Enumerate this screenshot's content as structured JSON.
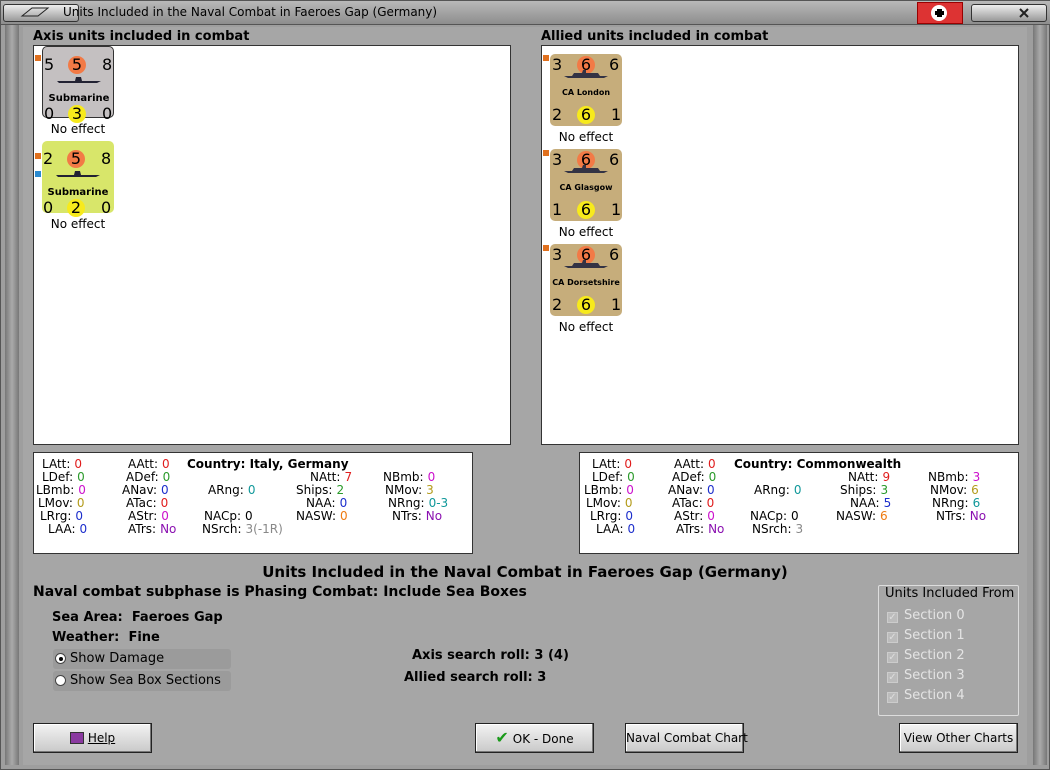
{
  "window": {
    "title": "Units Included in the Naval Combat in Faeroes Gap (Germany)"
  },
  "axis": {
    "heading": "Axis units included in combat",
    "units": [
      {
        "att": "5",
        "mid": "5",
        "def": "8",
        "name": "Submarine",
        "l": "0",
        "y": "3",
        "r": "0",
        "effect": "No effect"
      },
      {
        "att": "2",
        "mid": "5",
        "def": "8",
        "name": "Submarine",
        "l": "0",
        "y": "2",
        "r": "0",
        "effect": "No effect"
      }
    ],
    "stats": {
      "country_label": "Country:",
      "country": "Italy, Germany",
      "LAtt": "0",
      "LDef": "0",
      "LBmb": "0",
      "LMov": "0",
      "LRrg": "0",
      "LAA": "0",
      "AAtt": "0",
      "ADef": "0",
      "ANav": "0",
      "ATac": "0",
      "AStr": "0",
      "ATrs": "No",
      "ARng": "0",
      "NACp": "0",
      "NSrch": "3(-1R)",
      "NAtt": "7",
      "Ships": "2",
      "NAA": "0",
      "NASW": "0",
      "NBmb": "0",
      "NMov": "3",
      "NRng": "0-3",
      "NTrs": "No"
    }
  },
  "allied": {
    "heading": "Allied units included in combat",
    "units": [
      {
        "att": "3",
        "mid": "6",
        "def": "6",
        "name": "CA London",
        "l": "2",
        "y": "6",
        "r": "1",
        "effect": "No effect"
      },
      {
        "att": "3",
        "mid": "6",
        "def": "6",
        "name": "CA Glasgow",
        "l": "1",
        "y": "6",
        "r": "1",
        "effect": "No effect"
      },
      {
        "att": "3",
        "mid": "6",
        "def": "6",
        "name": "CA Dorsetshire",
        "l": "2",
        "y": "6",
        "r": "1",
        "effect": "No effect"
      }
    ],
    "stats": {
      "country_label": "Country:",
      "country": "Commonwealth",
      "LAtt": "0",
      "LDef": "0",
      "LBmb": "0",
      "LMov": "0",
      "LRrg": "0",
      "LAA": "0",
      "AAtt": "0",
      "ADef": "0",
      "ANav": "0",
      "ATac": "0",
      "AStr": "0",
      "ATrs": "No",
      "ARng": "0",
      "NACp": "0",
      "NSrch": "3",
      "NAtt": "9",
      "Ships": "3",
      "NAA": "5",
      "NASW": "6",
      "NBmb": "3",
      "NMov": "6",
      "NRng": "6",
      "NTrs": "No"
    }
  },
  "main_title": "Units Included in the Naval Combat in Faeroes Gap (Germany)",
  "subphase": "Naval combat subphase is Phasing Combat: Include Sea Boxes",
  "sea_area_label": "Sea Area:",
  "sea_area": "Faeroes Gap",
  "weather_label": "Weather:",
  "weather": "Fine",
  "options": {
    "show_damage": "Show Damage",
    "show_sections": "Show Sea Box Sections"
  },
  "search": {
    "axis_label": "Axis search roll:",
    "axis_value": "3 (4)",
    "allied_label": "Allied search roll:",
    "allied_value": "3"
  },
  "sections": {
    "caption": "Units Included From",
    "items": [
      "Section 0",
      "Section 1",
      "Section 2",
      "Section 3",
      "Section 4"
    ]
  },
  "buttons": {
    "help": "Help",
    "ok": "OK - Done",
    "naval_chart": "Naval Combat Chart",
    "other_charts": "View Other Charts"
  },
  "colors": {
    "accent_red": "#f27a46",
    "accent_yellow": "#f7ea1c",
    "sub_highlight": "#d8e66a",
    "cruiser_tan": "#c6ad7b"
  }
}
